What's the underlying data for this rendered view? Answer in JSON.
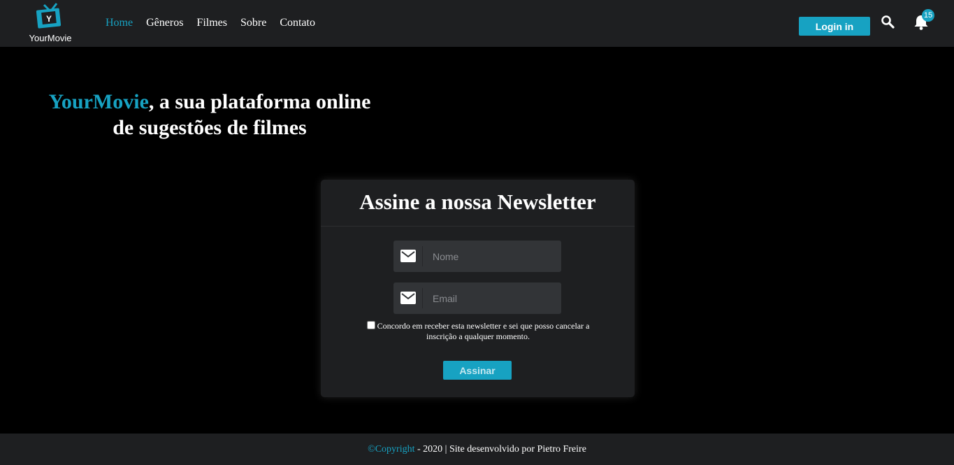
{
  "brand": {
    "logo_letter": "Y",
    "name": "YourMovie",
    "accent": "#17a2c2"
  },
  "nav": {
    "items": [
      {
        "label": "Home",
        "active": true
      },
      {
        "label": "Gêneros",
        "active": false
      },
      {
        "label": "Filmes",
        "active": false
      },
      {
        "label": "Sobre",
        "active": false
      },
      {
        "label": "Contato",
        "active": false
      }
    ],
    "login_label": "Login in",
    "search_icon": "search-icon",
    "bell_icon": "bell-icon",
    "notification_count": "15"
  },
  "hero": {
    "brand": "YourMovie",
    "line1_rest": ", a sua plataforma online",
    "line2": "de sugestões de filmes"
  },
  "newsletter": {
    "title": "Assine a nossa Newsletter",
    "name_placeholder": "Nome",
    "email_placeholder": "Email",
    "field_icon": "mail-icon",
    "consent_text": "Concordo em receber esta newsletter e sei que posso cancelar a inscrição a qualquer momento.",
    "consent_checked": false,
    "submit_label": "Assinar"
  },
  "footer": {
    "copyright": "©Copyright",
    "rest": " - 2020 | Site desenvolvido por Pietro Freire"
  }
}
